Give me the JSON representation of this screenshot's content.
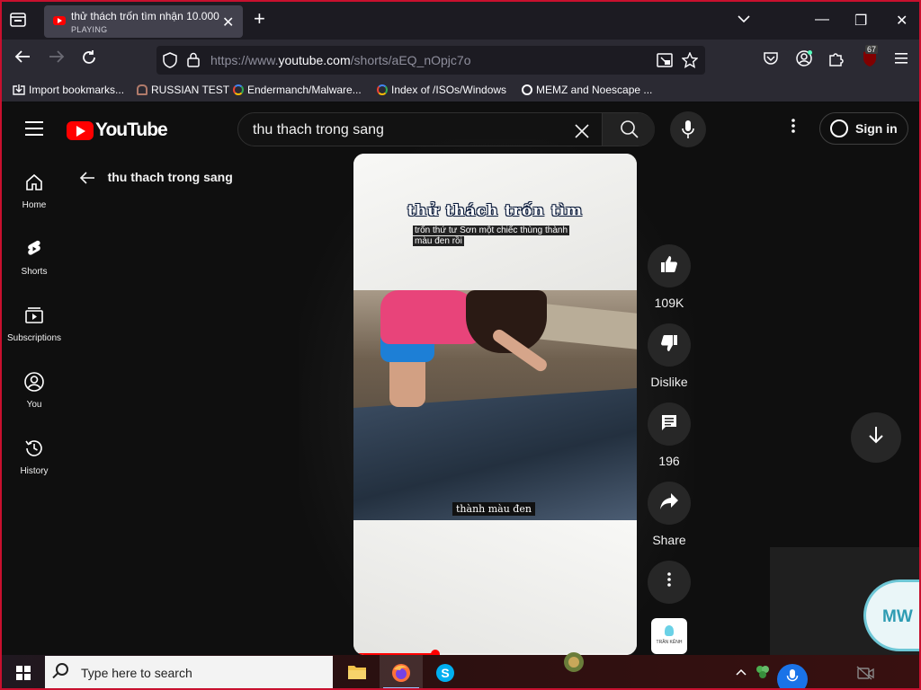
{
  "browser": {
    "tab": {
      "title": "thử thách trốn tìm nhận 10.000",
      "status": "PLAYING"
    },
    "new_tab_symbol": "+",
    "window_controls": {
      "list": "⌄",
      "minimize": "—",
      "restore": "❐",
      "close": "✕"
    },
    "url": {
      "prefix": "https://www.",
      "host": "youtube.com",
      "path": "/shorts/aEQ_nOpjc7o"
    },
    "extension_badge": "67",
    "bookmarks": [
      {
        "label": "Import bookmarks..."
      },
      {
        "label": "RUSSIAN TEST"
      },
      {
        "label": "Endermanch/Malware..."
      },
      {
        "label": "Index of /ISOs/Windows"
      },
      {
        "label": "MEMZ and Noescape ..."
      }
    ]
  },
  "youtube": {
    "logo_text": "YouTube",
    "search": {
      "query": "thu thach trong sang"
    },
    "sign_in_label": "Sign in",
    "guide": [
      {
        "label": "Home",
        "icon": "home-icon"
      },
      {
        "label": "Shorts",
        "icon": "shorts-icon"
      },
      {
        "label": "Subscriptions",
        "icon": "subscriptions-icon"
      },
      {
        "label": "You",
        "icon": "you-icon"
      },
      {
        "label": "History",
        "icon": "history-icon"
      }
    ],
    "back_label": "thu thach trong sang",
    "video": {
      "headline": "thử thách trốn tìm",
      "caption": "trốn thứ tư Sơn một chiếc thùng thành màu đen rồi",
      "subtitle": "thành màu đen",
      "progress": 0.29
    },
    "actions": {
      "like_count": "109K",
      "dislike_label": "Dislike",
      "comment_count": "196",
      "share_label": "Share"
    },
    "channel_thumb_text": "TRẦN KÊNH"
  },
  "overlay": {
    "avatar_initials": "MW"
  },
  "taskbar": {
    "search_placeholder": "Type here to search"
  },
  "colors": {
    "youtube_red": "#ff0000",
    "window_border": "#c8102e",
    "browser_bg": "#2b2a33"
  }
}
